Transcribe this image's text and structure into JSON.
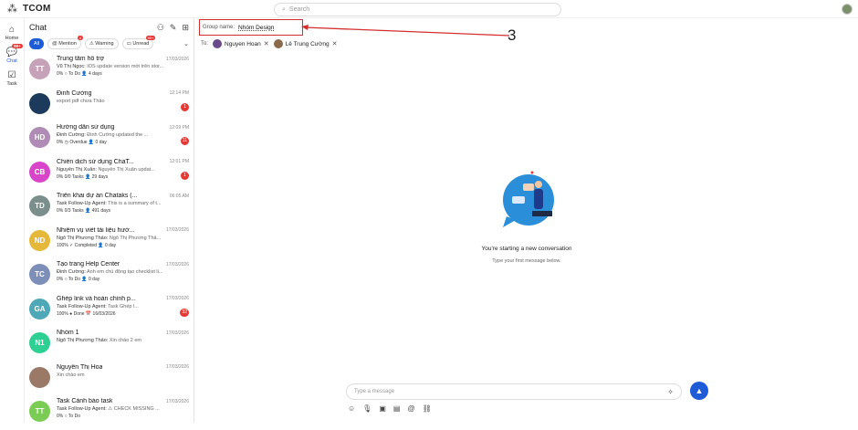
{
  "app": {
    "name": "TCOM",
    "search_placeholder": "Search"
  },
  "rail": [
    {
      "label": "Home",
      "icon": "home-icon"
    },
    {
      "label": "Chat",
      "icon": "chat-icon",
      "badge": "99+"
    },
    {
      "label": "Task",
      "icon": "task-icon"
    }
  ],
  "panel": {
    "title": "Chat",
    "filters": {
      "all": "All",
      "mention": "Mention",
      "mention_badge": "4",
      "warning": "Warning",
      "unread": "Unread",
      "unread_badge": "99+"
    },
    "items": [
      {
        "initials": "TT",
        "color": "#c6a2b8",
        "title": "Trung tâm hỗ trợ",
        "time": "17/03/2026",
        "sub_sender": "Vũ Thị Ngọc:",
        "sub_text": "IOS update version mới trên stor...",
        "meta": "0% ○ To Do  👤 4 days",
        "unread": ""
      },
      {
        "initials": "",
        "color": "#1b3a5c",
        "title": "Đinh Cường",
        "time": "12:14 PM",
        "sub_sender": "",
        "sub_text": "export pdf chưa Thảo",
        "meta": "",
        "unread": "1"
      },
      {
        "initials": "HD",
        "color": "#b08bb5",
        "title": "Hướng dẫn sử dụng",
        "time": "12:09 PM",
        "sub_sender": "Đinh Cường:",
        "sub_text": "Đinh Cường updated the ...",
        "meta": "0% ◷ Overdue  👤 0 day",
        "unread": "11"
      },
      {
        "initials": "CB",
        "color": "#d845c8",
        "title": "Chiến dịch sử dụng ChaT...",
        "time": "12:01 PM",
        "sub_sender": "Nguyễn Thị Xuân:",
        "sub_text": "Nguyễn Thị Xuân updat...",
        "meta": "0% 0/0 Tasks  👤 29 days",
        "unread": "1"
      },
      {
        "initials": "TD",
        "color": "#7a8f8c",
        "title": "Triển khai dự án Chataks (...",
        "time": "06:05 AM",
        "sub_sender": "Task Follow-Up Agent:",
        "sub_text": "This is a summary of t...",
        "meta": "0% 0/3 Tasks  👤 491 days",
        "unread": ""
      },
      {
        "initials": "ND",
        "color": "#e5b83a",
        "title": "Nhiệm vụ viết tài liệu hướ...",
        "time": "17/03/2026",
        "sub_sender": "Ngô Thị Phương Thảo:",
        "sub_text": "Ngô Thị Phương Thả...",
        "meta": "100% ✓ Completed  👤 0 day",
        "unread": ""
      },
      {
        "initials": "TC",
        "color": "#7d8fb8",
        "title": "Tạo trang Help Center",
        "time": "17/03/2026",
        "sub_sender": "Đinh Cường:",
        "sub_text": "Anh em chủ động tạo checklist li...",
        "meta": "0% ○ To Do  👤 0 day",
        "unread": ""
      },
      {
        "initials": "GA",
        "color": "#4ea8b8",
        "title": "Ghép link và hoàn chỉnh p...",
        "time": "17/03/2026",
        "sub_sender": "Task Follow-Up Agent:",
        "sub_text": "Task Ghép l...",
        "meta": "100% ● Done  📅 16/03/2026",
        "unread": "32"
      },
      {
        "initials": "N1",
        "color": "#2ecf92",
        "title": "Nhóm 1",
        "time": "17/03/2026",
        "sub_sender": "Ngô Thị Phương Thảo:",
        "sub_text": "Xin chào 2 em",
        "meta": "",
        "unread": ""
      },
      {
        "initials": "",
        "color": "#9a7a66",
        "title": "Nguyễn Thị Hoa",
        "time": "17/03/2026",
        "sub_sender": "",
        "sub_text": "Xin chào em",
        "meta": "",
        "unread": ""
      },
      {
        "initials": "TT",
        "color": "#7acc55",
        "title": "Task Cảnh báo task",
        "time": "17/03/2026",
        "sub_sender": "Task Follow-Up Agent:",
        "sub_text": "⚠ CHECK MISSING ...",
        "meta": "0% ○ To Do",
        "unread": ""
      }
    ]
  },
  "main": {
    "group_label": "Group name:",
    "group_value": "Nhóm Design",
    "annotation": "3",
    "to_label": "To:",
    "recipients": [
      "Nguyen Hoan",
      "Lê Trung Cường"
    ],
    "empty_title": "You're starting a new conversation",
    "empty_sub": "Type your first message below.",
    "compose_placeholder": "Type a message"
  }
}
